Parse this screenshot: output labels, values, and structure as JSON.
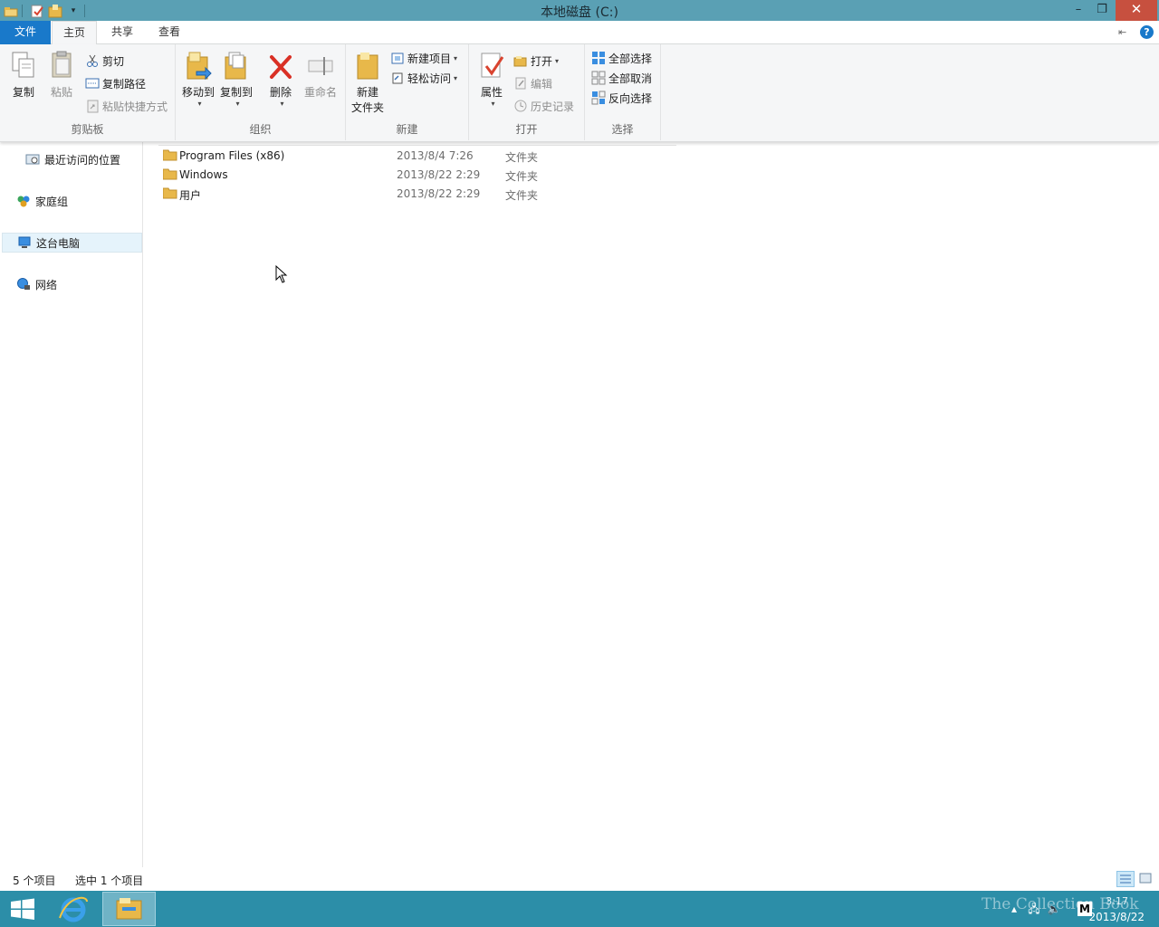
{
  "window": {
    "title": "本地磁盘 (C:)",
    "minimize": "–",
    "restore": "❐",
    "close": "✕"
  },
  "ribbon_tabs": {
    "file": "文件",
    "home": "主页",
    "share": "共享",
    "view": "查看"
  },
  "ribbon": {
    "clipboard": {
      "label": "剪贴板",
      "copy": "复制",
      "paste": "粘贴",
      "cut": "剪切",
      "copy_path": "复制路径",
      "paste_shortcut": "粘贴快捷方式"
    },
    "organize": {
      "label": "组织",
      "move_to": "移动到",
      "copy_to": "复制到",
      "delete": "删除",
      "rename": "重命名"
    },
    "new": {
      "label": "新建",
      "new_folder_line1": "新建",
      "new_folder_line2": "文件夹",
      "new_item": "新建项目",
      "easy_access": "轻松访问"
    },
    "open": {
      "label": "打开",
      "properties": "属性",
      "open": "打开",
      "edit": "编辑",
      "history": "历史记录"
    },
    "select": {
      "label": "选择",
      "select_all": "全部选择",
      "select_none": "全部取消",
      "invert": "反向选择"
    }
  },
  "nav": {
    "recent": "最近访问的位置",
    "homegroup": "家庭组",
    "this_pc": "这台电脑",
    "network": "网络"
  },
  "files": [
    {
      "name": "Program Files (x86)",
      "date": "2013/8/4 7:26",
      "type": "文件夹"
    },
    {
      "name": "Windows",
      "date": "2013/8/22 2:29",
      "type": "文件夹"
    },
    {
      "name": "用户",
      "date": "2013/8/22 2:29",
      "type": "文件夹"
    }
  ],
  "status": {
    "count": "5 个项目",
    "selected": "选中 1 个项目"
  },
  "taskbar": {
    "time": "3:17",
    "date": "2013/8/22",
    "watermark": "The Collection Book"
  },
  "colors": {
    "titlebar": "#5aa0b4",
    "file_tab": "#1979ca",
    "close_button": "#c7503f",
    "taskbar": "#2c8ea8",
    "folder": "#e8b84a"
  }
}
